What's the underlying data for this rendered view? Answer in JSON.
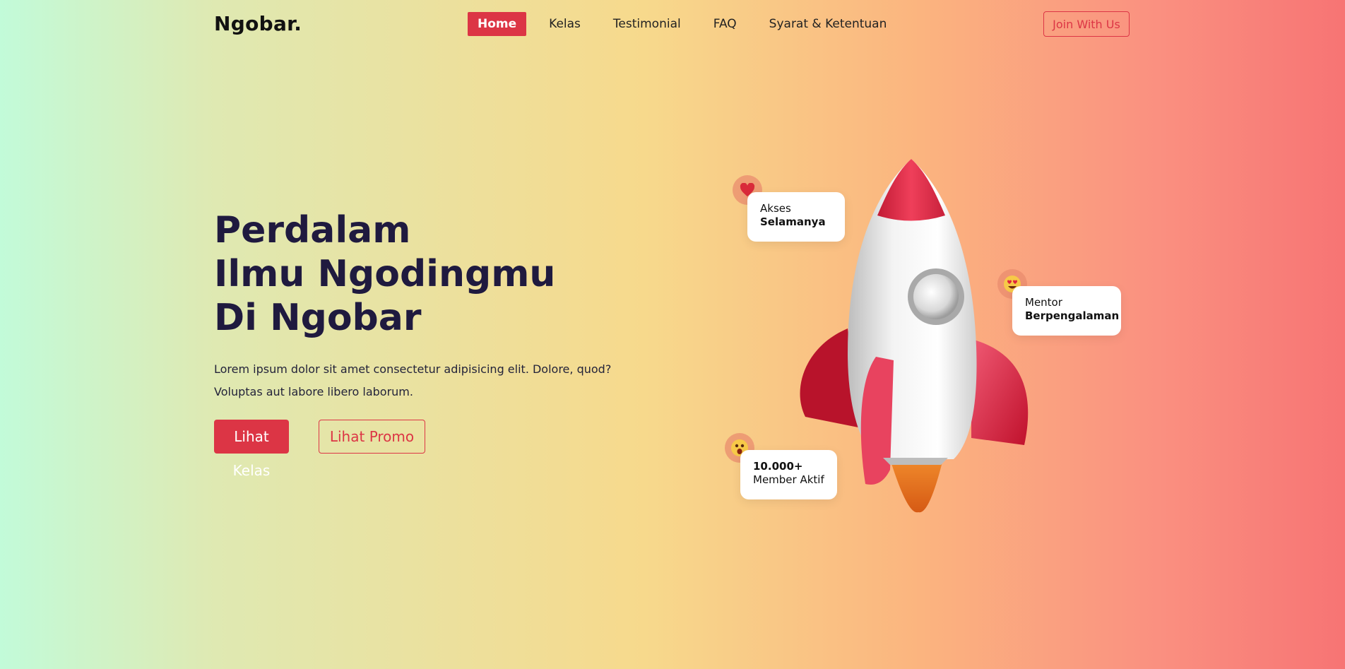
{
  "nav": {
    "logo": "Ngobar.",
    "items": [
      {
        "label": "Home",
        "active": true
      },
      {
        "label": "Kelas",
        "active": false
      },
      {
        "label": "Testimonial",
        "active": false
      },
      {
        "label": "FAQ",
        "active": false
      },
      {
        "label": "Syarat & Ketentuan",
        "active": false
      }
    ],
    "cta": "Join With Us"
  },
  "hero": {
    "title_line1": "Perdalam",
    "title_line2_prefix": "Ilmu ",
    "title_line2_strong": "Ngodingmu",
    "title_line3": "Di Ngobar",
    "description": "Lorem ipsum dolor sit amet consectetur adipisicing elit. Dolore, quod? Voluptas aut labore libero laborum.",
    "primary_button": "Lihat Kelas",
    "secondary_button": "Lihat Promo"
  },
  "floating_cards": {
    "lifetime": {
      "line1": "Akses",
      "line2": "Selamanya",
      "icon": "heart-icon"
    },
    "mentor": {
      "line1": "Mentor",
      "line2": "Berpengalaman",
      "icon": "heart-eyes-emoji-icon"
    },
    "members": {
      "line1": "10.000+",
      "line2": "Member Aktif",
      "icon": "shocked-emoji-icon"
    }
  },
  "colors": {
    "accent": "#dc3545",
    "text_dark": "#1f1a3f",
    "gradient": [
      "#c2fbd9",
      "#f7d98c",
      "#f77474"
    ]
  }
}
